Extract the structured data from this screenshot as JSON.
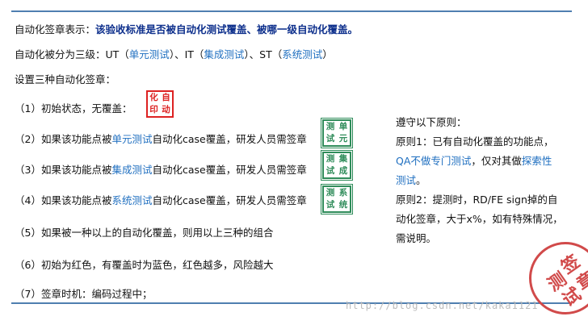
{
  "intro": {
    "label": "自动化签章表示：",
    "emphasis": "该验收标准是否被自动化测试覆盖、被哪一级自动化覆盖。"
  },
  "levels": {
    "prefix": "自动化被分为三级：UT（",
    "ut": "单元测试",
    "mid1": "）、IT（",
    "it": "集成测试",
    "mid2": "）、ST（",
    "st": "系统测试",
    "suffix": "）"
  },
  "setup": "设置三种自动化签章：",
  "items": {
    "i1": {
      "text": "（1）初始状态，无覆盖："
    },
    "i2": {
      "pre": "（2）如果该功能点被",
      "link": "单元测试",
      "post": "自动化case覆盖，研发人员需签章"
    },
    "i3": {
      "pre": "（3）如果该功能点被",
      "link": "集成测试",
      "post": "自动化case覆盖，研发人员需签章"
    },
    "i4": {
      "pre": "（4）如果该功能点被",
      "link": "系统测试",
      "post": "自动化case覆盖，研发人员需签章"
    },
    "i5": {
      "text": "（5）如果被一种以上的自动化覆盖，则用以上三种的组合"
    },
    "i6": {
      "text": "（6）初始为红色，有覆盖时为蓝色，红色越多，风险越大"
    },
    "i7": {
      "text": "（7）签章时机：编码过程中；"
    }
  },
  "stamps": {
    "initial": [
      "化",
      "自",
      "印",
      "动"
    ],
    "unit": [
      "测",
      "单",
      "试",
      "元"
    ],
    "integration": [
      "测",
      "集",
      "试",
      "成"
    ],
    "system": [
      "测",
      "系",
      "试",
      "统"
    ]
  },
  "rules": {
    "heading": "遵守以下原则：",
    "r1_a": "原则1：已有自动化覆盖的功能点，",
    "r1_b_link": "QA不做专门测试",
    "r1_b_text": "，仅对其做",
    "r1_b_link2": "探索性",
    "r1_c_link": "测试",
    "r1_c_text": "。",
    "r2_a": "原则2：提测时，RD/FE sign掉的自",
    "r2_b": "动化签章，大于x%，如有特殊情况，",
    "r2_c": "需说明。"
  },
  "watermark": "http://blog.csdn.net/kaka1121",
  "seal": [
    "测",
    "签",
    "试",
    "章"
  ],
  "colors": {
    "blue": "#1f6fc0",
    "rule_line": "#4f7fb0",
    "stamp_red": "#d22222",
    "stamp_green": "#2f8c5a"
  }
}
